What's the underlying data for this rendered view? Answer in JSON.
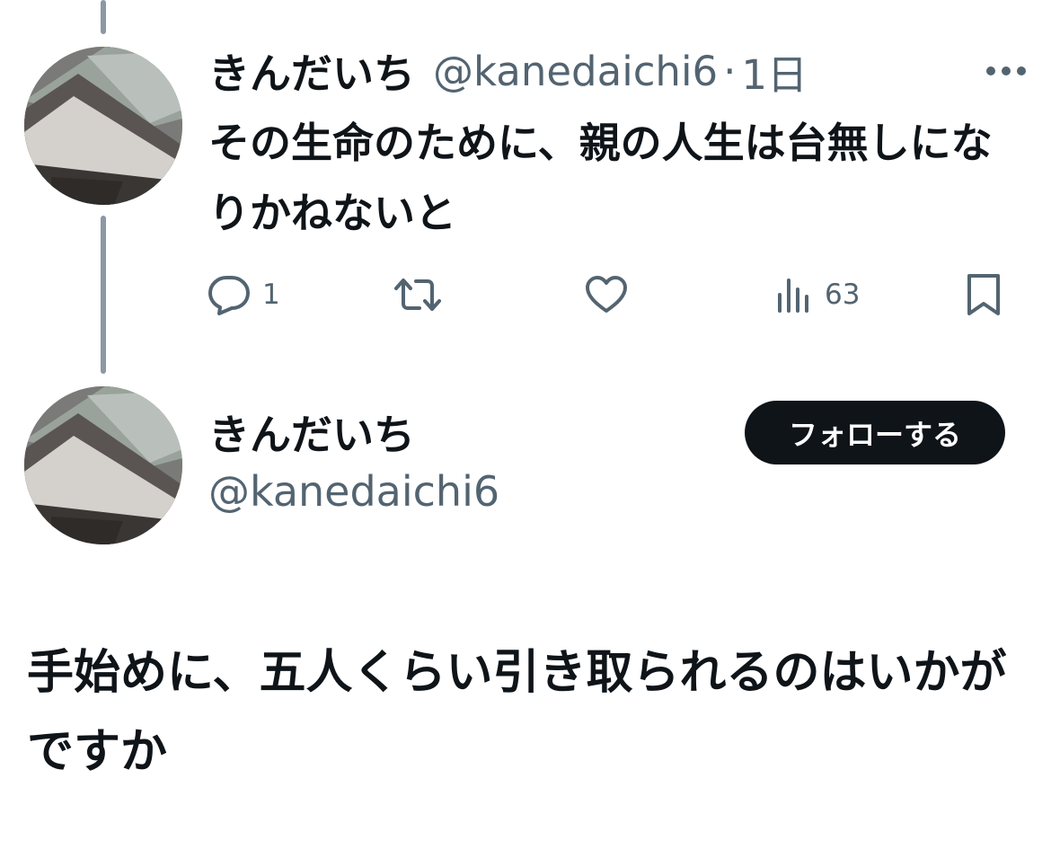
{
  "thread": {
    "reply_tweet": {
      "display_name": "きんだいち",
      "handle": "@kanedaichi6",
      "separator": "·",
      "time": "1日",
      "text": "その生命のために、親の人生は台無しになりかねないと",
      "actions": {
        "reply_count": "1",
        "retweet_count": "",
        "like_count": "",
        "views_count": "63"
      }
    },
    "main_tweet": {
      "display_name": "きんだいち",
      "handle": "@kanedaichi6",
      "follow_label": "フォローする",
      "text": "手始めに、五人くらい引き取られるのはいかがですか"
    }
  },
  "icons": {
    "reply": "speech-bubble-icon",
    "retweet": "retweet-icon",
    "like": "heart-icon",
    "views": "bar-chart-icon",
    "bookmark": "bookmark-icon",
    "more": "more-horizontal-icon"
  },
  "colors": {
    "text_primary": "#0f1419",
    "text_secondary": "#536471",
    "follow_button_bg": "#0f1419",
    "thread_line": "#8b98a5"
  }
}
